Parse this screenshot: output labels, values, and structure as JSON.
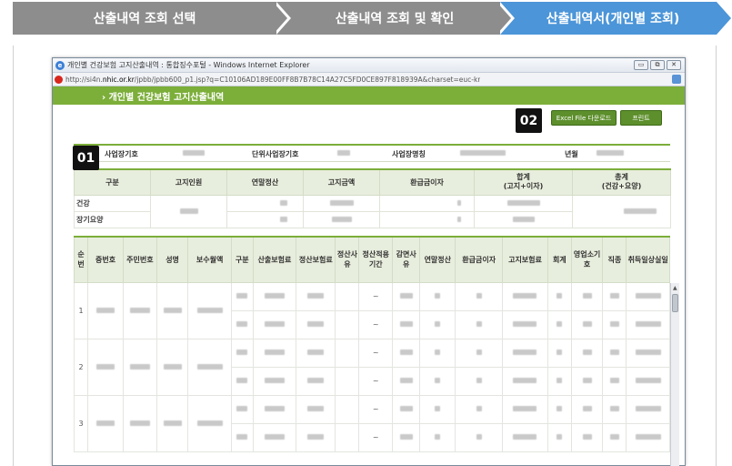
{
  "steps": [
    {
      "label": "산출내역 조회 선택"
    },
    {
      "label": "산출내역 조회 및 확인"
    },
    {
      "label": "산출내역서(개인별 조회)"
    }
  ],
  "window": {
    "title": "개인별 건강보험 고지산출내역 : 통합징수포털 - Windows Internet Explorer",
    "url_prefix": "http://si4n.",
    "url_host": "nhic.or.kr",
    "url_rest": "/jpbb/jpbb600_p1.jsp?q=C10106AD189E00FF8B7B78C14A27C5FD0CE897F818939A&charset=euc-kr",
    "buttons": [
      "▭",
      "⧉",
      "✕"
    ]
  },
  "page": {
    "header": "› 개인별 건강보험 고지산출내역",
    "badge_02": "02",
    "badge_01": "01",
    "excel_label": "Excel File 다운로드",
    "print_label": "프린트"
  },
  "info_row": {
    "bizno_label": "사업장기호",
    "unit_label": "단위사업장기호",
    "name_label": "사업장명칭",
    "month_label": "년월"
  },
  "summary": {
    "headers": [
      "구분",
      "고지인원",
      "연말정산",
      "고지금액",
      "환급금이자",
      "합계\n(고지+이자)",
      "총계\n(건강+요양)"
    ],
    "rows": [
      {
        "label": "건강"
      },
      {
        "label": "장기요양"
      }
    ]
  },
  "detail": {
    "headers": [
      "순번",
      "증번호",
      "주민번호",
      "성명",
      "보수월액",
      "구분",
      "산출보험료",
      "정산보험료",
      "정산사유",
      "정산적용기간",
      "감면사유",
      "연말정산",
      "환급금이자",
      "고지보험료",
      "회계",
      "영업소기호",
      "직종",
      "취득일상실일"
    ],
    "rows": [
      {
        "no": "1",
        "period_a": "~",
        "period_b": "~"
      },
      {
        "no": "2",
        "period_a": "~",
        "period_b": "~"
      },
      {
        "no": "3",
        "period_a": "~",
        "period_b": "~"
      }
    ]
  }
}
